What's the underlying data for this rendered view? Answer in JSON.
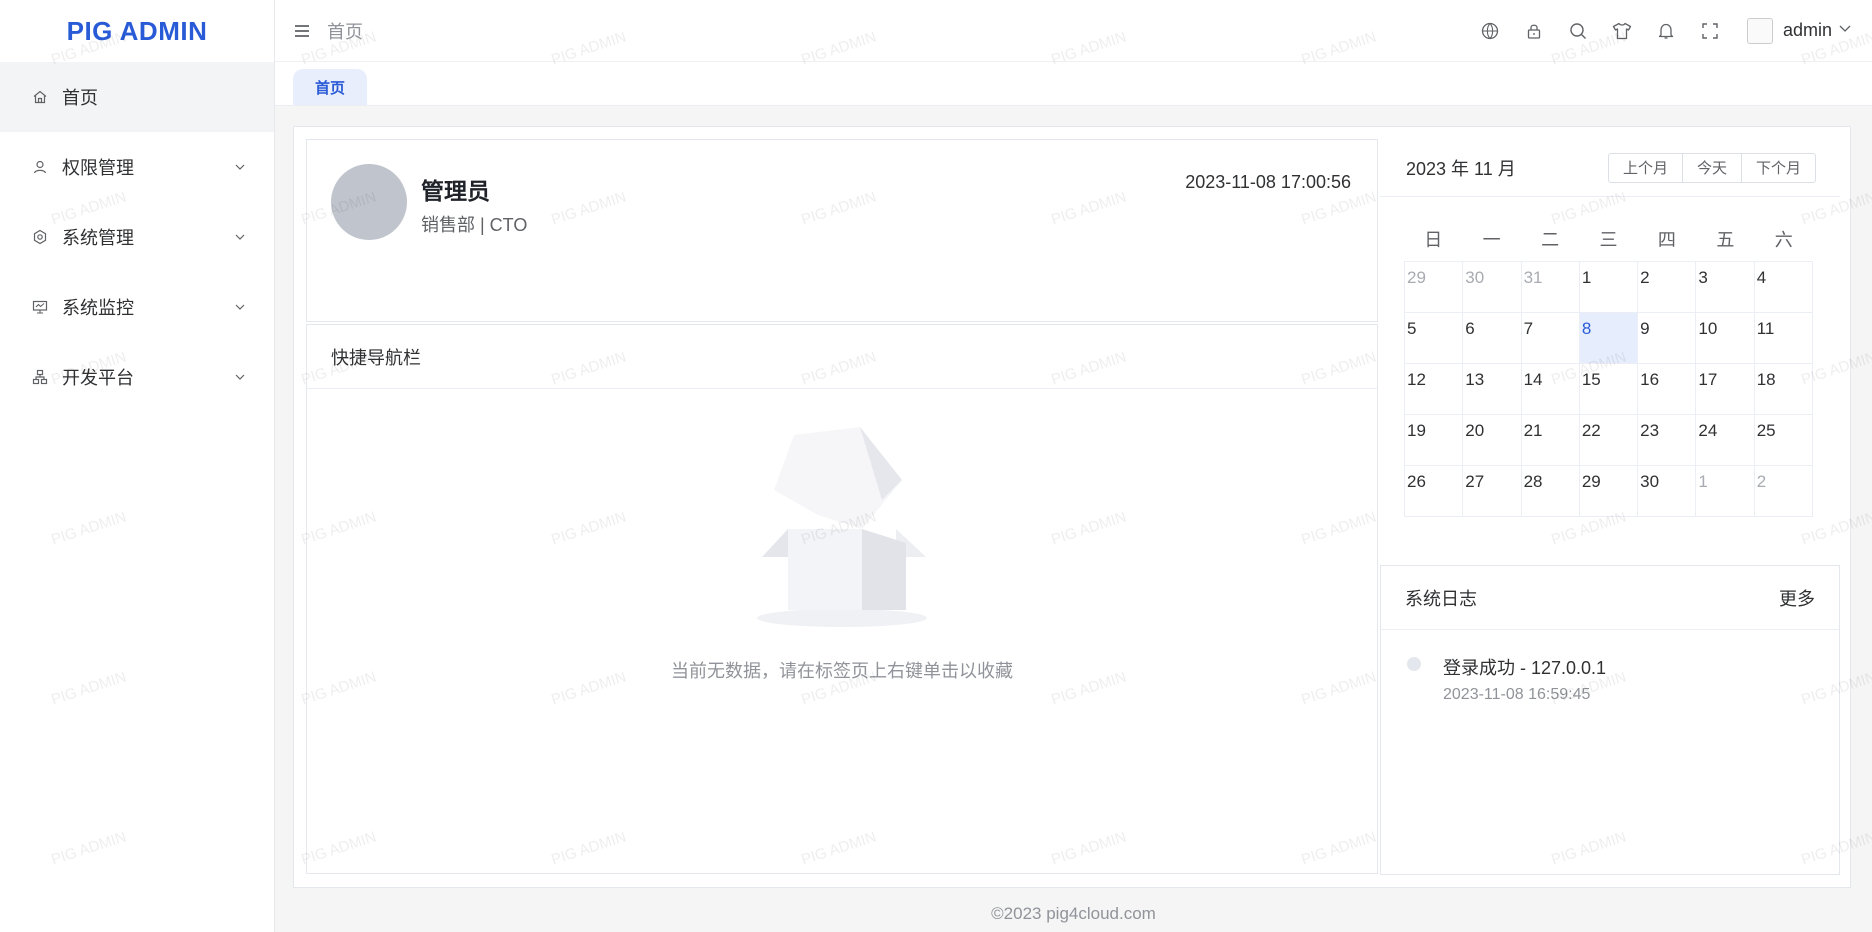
{
  "app": {
    "logo": "PIG ADMIN"
  },
  "sidebar": {
    "items": [
      {
        "label": "首页",
        "icon": "home-icon",
        "active": true
      },
      {
        "label": "权限管理",
        "icon": "user-icon"
      },
      {
        "label": "系统管理",
        "icon": "settings-icon"
      },
      {
        "label": "系统监控",
        "icon": "monitor-icon"
      },
      {
        "label": "开发平台",
        "icon": "sitemap-icon"
      }
    ]
  },
  "header": {
    "breadcrumb": "首页",
    "icons": [
      "globe-icon",
      "lock-icon",
      "search-icon",
      "theme-icon",
      "bell-icon",
      "fullscreen-icon"
    ],
    "username": "admin"
  },
  "tabs": [
    {
      "label": "首页"
    }
  ],
  "profile": {
    "name": "管理员",
    "dept": "销售部 | CTO",
    "time": "2023-11-08 17:00:56"
  },
  "quick_nav": {
    "title": "快捷导航栏",
    "empty_text": "当前无数据，请在标签页上右键单击以收藏"
  },
  "calendar": {
    "title": "2023 年 11 月",
    "buttons": {
      "prev": "上个月",
      "today": "今天",
      "next": "下个月"
    },
    "weekdays": [
      "日",
      "一",
      "二",
      "三",
      "四",
      "五",
      "六"
    ],
    "days": [
      {
        "d": "29",
        "other": true
      },
      {
        "d": "30",
        "other": true
      },
      {
        "d": "31",
        "other": true
      },
      {
        "d": "1"
      },
      {
        "d": "2"
      },
      {
        "d": "3"
      },
      {
        "d": "4"
      },
      {
        "d": "5"
      },
      {
        "d": "6"
      },
      {
        "d": "7"
      },
      {
        "d": "8",
        "today": true
      },
      {
        "d": "9"
      },
      {
        "d": "10"
      },
      {
        "d": "11"
      },
      {
        "d": "12"
      },
      {
        "d": "13"
      },
      {
        "d": "14"
      },
      {
        "d": "15"
      },
      {
        "d": "16"
      },
      {
        "d": "17"
      },
      {
        "d": "18"
      },
      {
        "d": "19"
      },
      {
        "d": "20"
      },
      {
        "d": "21"
      },
      {
        "d": "22"
      },
      {
        "d": "23"
      },
      {
        "d": "24"
      },
      {
        "d": "25"
      },
      {
        "d": "26"
      },
      {
        "d": "27"
      },
      {
        "d": "28"
      },
      {
        "d": "29"
      },
      {
        "d": "30"
      },
      {
        "d": "1",
        "other": true
      },
      {
        "d": "2",
        "other": true
      }
    ]
  },
  "system_log": {
    "title": "系统日志",
    "more": "更多",
    "entries": [
      {
        "text": "登录成功 - 127.0.0.1",
        "time": "2023-11-08 16:59:45"
      }
    ]
  },
  "footer": "©2023 pig4cloud.com",
  "watermark": "PIG ADMIN",
  "colors": {
    "accent": "#2a5bd7",
    "today_bg": "#e6edfd",
    "tab_bg": "#e8eefb"
  }
}
